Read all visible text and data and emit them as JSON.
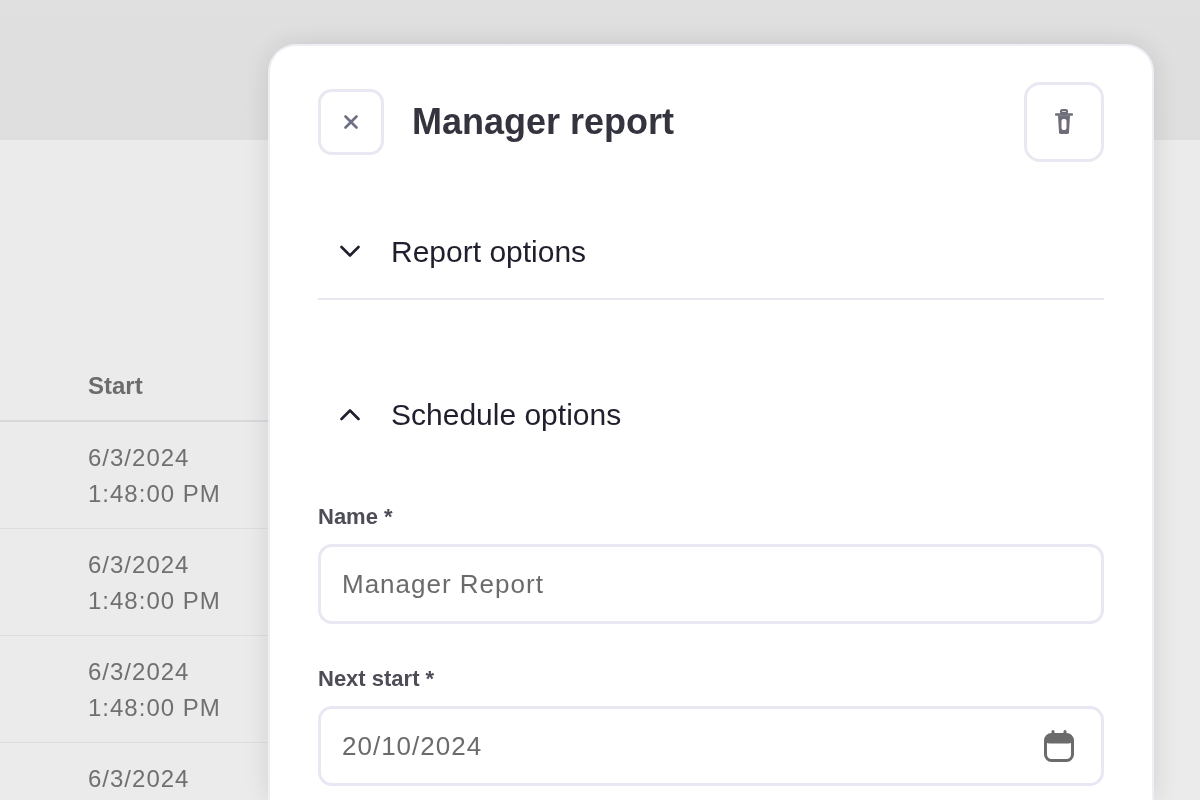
{
  "background": {
    "table": {
      "columns": [
        "Start"
      ],
      "rows": [
        [
          "6/3/2024 1:48:00 PM"
        ],
        [
          "6/3/2024 1:48:00 PM"
        ],
        [
          "6/3/2024 1:48:00 PM"
        ],
        [
          "6/3/2024"
        ]
      ]
    }
  },
  "dialog": {
    "title": "Manager report",
    "sections": [
      {
        "title": "Report options",
        "expanded": false
      },
      {
        "title": "Schedule options",
        "expanded": true,
        "fields": [
          {
            "label": "Name *",
            "kind": "text",
            "value": "Manager Report"
          },
          {
            "label": "Next start *",
            "kind": "date",
            "value": "20/10/2024"
          }
        ]
      }
    ]
  }
}
